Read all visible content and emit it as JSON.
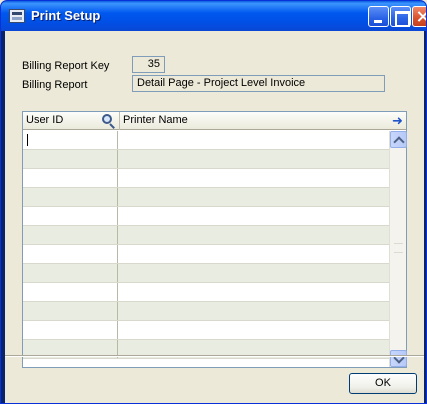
{
  "window": {
    "title": "Print Setup"
  },
  "form": {
    "billing_report_key_label": "Billing Report Key",
    "billing_report_key_value": "35",
    "billing_report_label": "Billing Report",
    "billing_report_value": "Detail Page - Project Level Invoice"
  },
  "grid": {
    "columns": [
      "User ID",
      "Printer Name"
    ],
    "rows": [
      {
        "user_id": "",
        "printer_name": ""
      },
      {
        "user_id": "",
        "printer_name": ""
      },
      {
        "user_id": "",
        "printer_name": ""
      },
      {
        "user_id": "",
        "printer_name": ""
      },
      {
        "user_id": "",
        "printer_name": ""
      },
      {
        "user_id": "",
        "printer_name": ""
      },
      {
        "user_id": "",
        "printer_name": ""
      },
      {
        "user_id": "",
        "printer_name": ""
      },
      {
        "user_id": "",
        "printer_name": ""
      },
      {
        "user_id": "",
        "printer_name": ""
      },
      {
        "user_id": "",
        "printer_name": ""
      },
      {
        "user_id": "",
        "printer_name": ""
      }
    ]
  },
  "buttons": {
    "ok_label": "OK"
  },
  "icons": {
    "window": "window-icon",
    "lookup": "magnifier-icon",
    "expand": "arrow-right-icon"
  }
}
